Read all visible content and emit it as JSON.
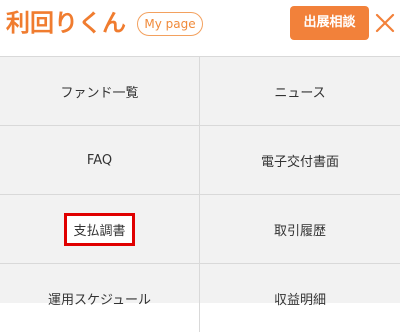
{
  "header": {
    "logo_text": "利回りくん",
    "mypage_label": "My page",
    "consult_label": "出展相談",
    "close_icon": "close-x-icon"
  },
  "menu": {
    "items": [
      {
        "label": "ファンド一覧"
      },
      {
        "label": "ニュース"
      },
      {
        "label": "FAQ"
      },
      {
        "label": "電子交付書面"
      },
      {
        "label": "支払調書",
        "highlighted": true
      },
      {
        "label": "取引履歴"
      },
      {
        "label": "運用スケジュール"
      },
      {
        "label": "収益明細"
      }
    ]
  },
  "colors": {
    "accent": "#f2813a",
    "highlight": "#e00000",
    "menu_bg": "#f2f2f2",
    "divider": "#d9d9d9"
  }
}
